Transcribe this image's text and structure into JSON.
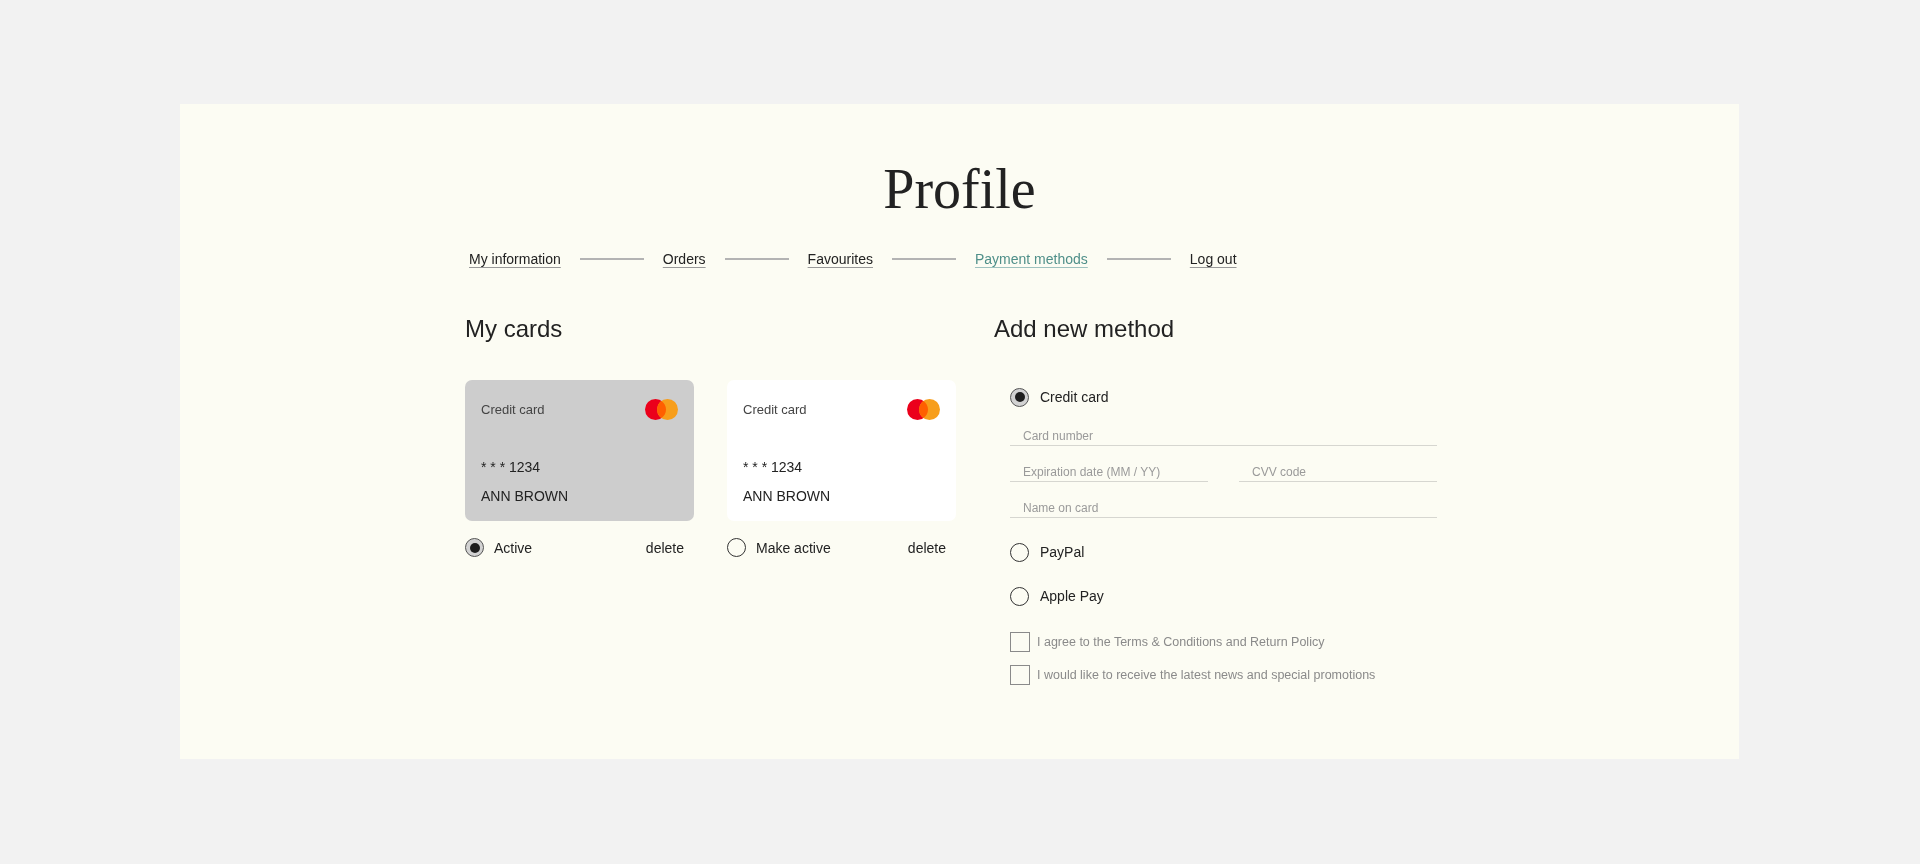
{
  "page": {
    "title": "Profile"
  },
  "nav": [
    {
      "label": "My information",
      "selected": false
    },
    {
      "label": "Orders",
      "selected": false
    },
    {
      "label": "Favourites",
      "selected": false
    },
    {
      "label": "Payment methods",
      "selected": true
    },
    {
      "label": "Log out",
      "selected": false
    }
  ],
  "my_cards": {
    "heading": "My cards",
    "cards": [
      {
        "type_label": "Credit card",
        "number": "* * * 1234",
        "holder": "ANN BROWN",
        "selected": true,
        "status_label": "Active",
        "delete_label": "delete"
      },
      {
        "type_label": "Credit card",
        "number": "* * * 1234",
        "holder": "ANN BROWN",
        "selected": false,
        "status_label": "Make active",
        "delete_label": "delete"
      }
    ]
  },
  "add_method": {
    "heading": "Add new method",
    "options": [
      {
        "label": "Credit card",
        "selected": true,
        "field_rows": [
          [
            {
              "placeholder": "Card number"
            }
          ],
          [
            {
              "placeholder": "Expiration date (MM / YY)"
            },
            {
              "placeholder": "CVV code"
            }
          ],
          [
            {
              "placeholder": "Name on card"
            }
          ]
        ]
      },
      {
        "label": "PayPal",
        "selected": false
      },
      {
        "label": "Apple Pay",
        "selected": false
      }
    ],
    "agreements": [
      {
        "label": "I agree to the Terms & Conditions and Return Policy",
        "checked": false
      },
      {
        "label": "I would like to receive the latest news and special promotions",
        "checked": false
      }
    ]
  }
}
